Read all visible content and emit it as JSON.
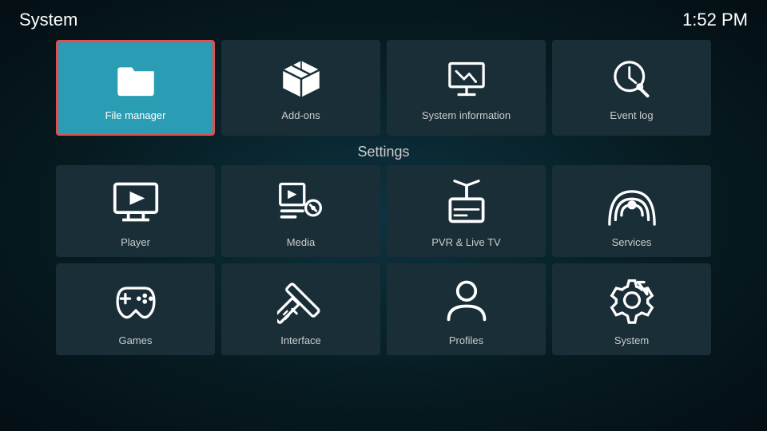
{
  "header": {
    "title": "System",
    "time": "1:52 PM"
  },
  "top_tiles": [
    {
      "id": "file-manager",
      "label": "File manager",
      "highlighted": true,
      "icon": "folder"
    },
    {
      "id": "add-ons",
      "label": "Add-ons",
      "highlighted": false,
      "icon": "box"
    },
    {
      "id": "system-information",
      "label": "System information",
      "highlighted": false,
      "icon": "presentation"
    },
    {
      "id": "event-log",
      "label": "Event log",
      "highlighted": false,
      "icon": "clock-search"
    }
  ],
  "settings_label": "Settings",
  "settings_tiles_row1": [
    {
      "id": "player",
      "label": "Player",
      "icon": "monitor-play"
    },
    {
      "id": "media",
      "label": "Media",
      "icon": "media"
    },
    {
      "id": "pvr-live-tv",
      "label": "PVR & Live TV",
      "icon": "tv-antenna"
    },
    {
      "id": "services",
      "label": "Services",
      "icon": "broadcast"
    }
  ],
  "settings_tiles_row2": [
    {
      "id": "games",
      "label": "Games",
      "icon": "gamepad"
    },
    {
      "id": "interface",
      "label": "Interface",
      "icon": "pencil-ruler"
    },
    {
      "id": "profiles",
      "label": "Profiles",
      "icon": "person"
    },
    {
      "id": "system",
      "label": "System",
      "icon": "gear-fork"
    }
  ]
}
